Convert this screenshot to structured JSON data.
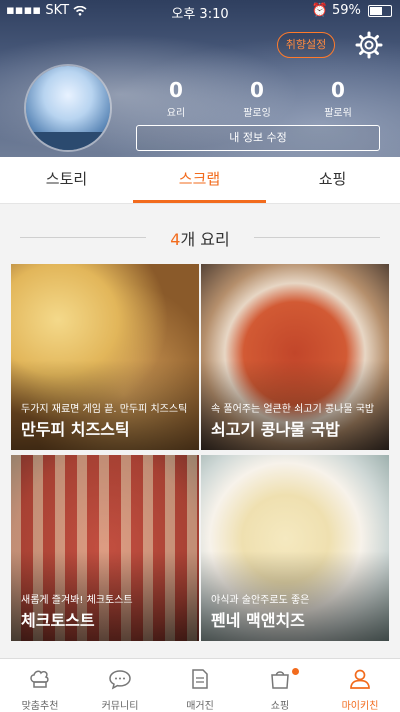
{
  "status": {
    "carrier": "SKT",
    "time": "오후 3:10",
    "battery": "59%",
    "battery_level": 0.59
  },
  "header": {
    "pref_button": "취향설정"
  },
  "stats": [
    {
      "value": "0",
      "label": "요리"
    },
    {
      "value": "0",
      "label": "팔로잉"
    },
    {
      "value": "0",
      "label": "팔로워"
    }
  ],
  "profile": {
    "edit_button": "내 정보 수정"
  },
  "tabs": [
    {
      "label": "스토리"
    },
    {
      "label": "스크랩"
    },
    {
      "label": "쇼핑"
    }
  ],
  "scrap": {
    "count": "4",
    "count_suffix": "개 요리"
  },
  "recipes": [
    {
      "subtitle": "두가지 재료면 게임 끝. 만두피 치즈스틱",
      "title": "만두피 치즈스틱"
    },
    {
      "subtitle": "속 풀어주는 얼큰한 쇠고기 콩나물 국밥",
      "title": "쇠고기 콩나물 국밥"
    },
    {
      "subtitle": "새롭게 즐겨봐! 체크토스트",
      "title": "체크토스트"
    },
    {
      "subtitle": "야식과 술안주로도 좋은",
      "title": "펜네 맥앤치즈"
    }
  ],
  "nav": [
    {
      "label": "맞춤추천",
      "icon": "chef-hat-icon"
    },
    {
      "label": "커뮤니티",
      "icon": "chat-bubble-icon"
    },
    {
      "label": "매거진",
      "icon": "document-icon"
    },
    {
      "label": "쇼핑",
      "icon": "shopping-bag-icon"
    },
    {
      "label": "마이키친",
      "icon": "person-icon"
    }
  ],
  "colors": {
    "accent": "#f26b1d"
  }
}
